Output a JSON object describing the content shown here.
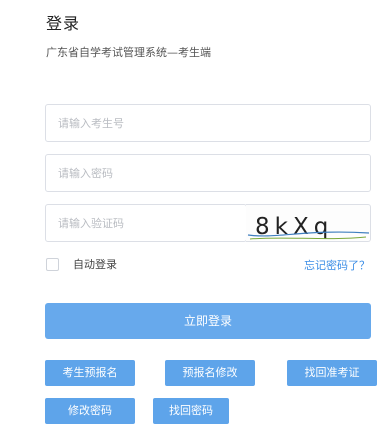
{
  "header": {
    "title": "登录",
    "subtitle": "广东省自学考试管理系统—考生端"
  },
  "form": {
    "username_placeholder": "请输入考生号",
    "password_placeholder": "请输入密码",
    "captcha_placeholder": "请输入验证码",
    "captcha_text": "8kXq",
    "remember_label": "自动登录",
    "forgot_label": "忘记密码了？",
    "login_button": "立即登录"
  },
  "actions": {
    "pre_register": "考生预报名",
    "edit_pre_register": "预报名修改",
    "recover_admission_number": "找回准考证",
    "change_password": "修改密码",
    "recover_password": "找回密码"
  },
  "colors": {
    "primary": "#67a9ec",
    "secondary_button": "#5ea4ea",
    "link": "#3c8ee6"
  }
}
